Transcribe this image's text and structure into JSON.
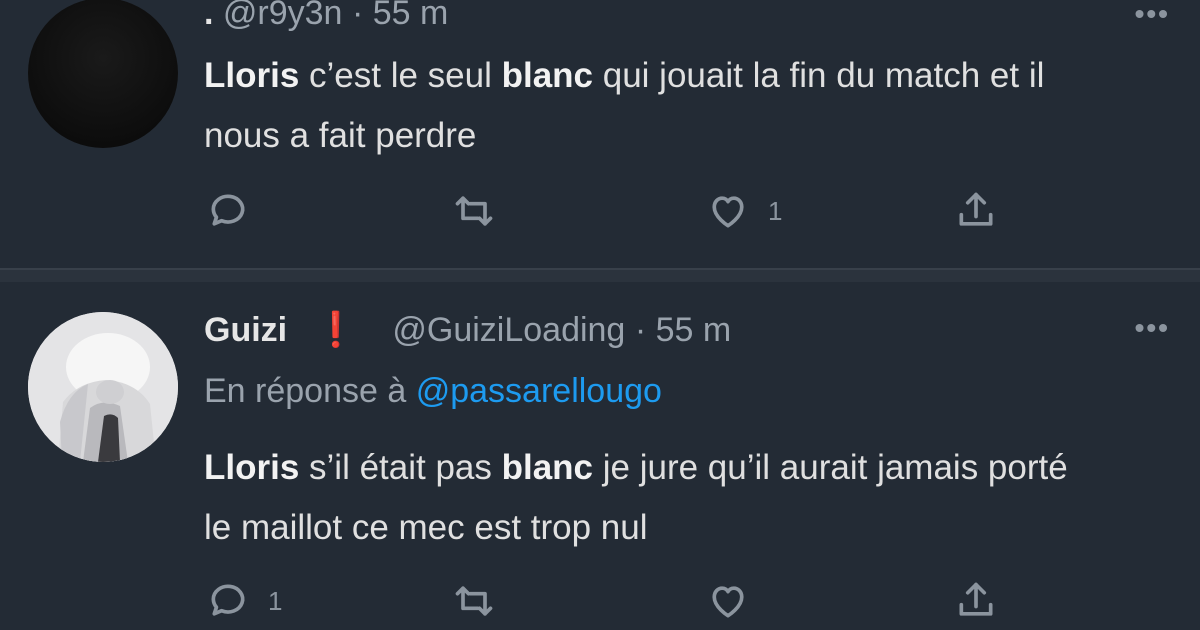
{
  "tweets": [
    {
      "display_name": ".",
      "handle": "@r9y3n",
      "separator": "·",
      "time": "55 m",
      "reply_to_prefix": "",
      "reply_to_handle": "",
      "text_segments": [
        {
          "text": "Lloris",
          "bold": true
        },
        {
          "text": " c’est le seul ",
          "bold": false
        },
        {
          "text": "blanc",
          "bold": true
        },
        {
          "text": " qui jouait la fin du match et il nous a fait perdre",
          "bold": false
        }
      ],
      "actions": {
        "reply_count": "",
        "retweet_count": "",
        "like_count": "1"
      }
    },
    {
      "display_name": "Guizi",
      "badge": "❗",
      "handle": "@GuiziLoading",
      "separator": "·",
      "time": "55 m",
      "reply_to_prefix": "En réponse à",
      "reply_to_handle": "@passarellougo",
      "text_segments": [
        {
          "text": "Lloris",
          "bold": true
        },
        {
          "text": " s’il était pas ",
          "bold": false
        },
        {
          "text": "blanc",
          "bold": true
        },
        {
          "text": " je jure qu’il aurait jamais porté le maillot ce mec est trop nul",
          "bold": false
        }
      ],
      "actions": {
        "reply_count": "1",
        "retweet_count": "",
        "like_count": ""
      }
    }
  ],
  "more_menu_glyph": "•••",
  "icons": [
    "reply-icon",
    "retweet-icon",
    "like-icon",
    "share-icon",
    "more-icon",
    "warning-badge-icon"
  ]
}
